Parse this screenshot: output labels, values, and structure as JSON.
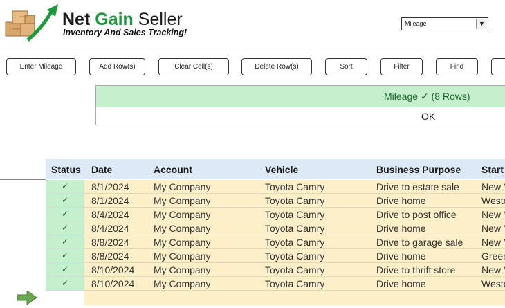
{
  "brand": {
    "title_net": "Net",
    "title_gain": "Gain",
    "title_seller": "Seller",
    "subtitle": "Inventory And Sales Tracking!"
  },
  "sheet_selector": {
    "value": "Mileage"
  },
  "toolbar": {
    "buttons": [
      "Enter Mileage",
      "Add Row(s)",
      "Clear Cell(s)",
      "Delete Row(s)",
      "Sort",
      "Filter",
      "Find",
      ""
    ]
  },
  "banner": {
    "text": "Mileage ✓ (8 Rows)",
    "ok": "OK"
  },
  "table": {
    "headers": [
      "Status",
      "Date",
      "Account",
      "Vehicle",
      "Business Purpose",
      "Start"
    ],
    "rows": [
      {
        "status": "✓",
        "date": "8/1/2024",
        "account": "My Company",
        "vehicle": "Toyota Camry",
        "purpose": "Drive to estate sale",
        "start": "New Y"
      },
      {
        "status": "✓",
        "date": "8/1/2024",
        "account": "My Company",
        "vehicle": "Toyota Camry",
        "purpose": "Drive home",
        "start": "Westc"
      },
      {
        "status": "✓",
        "date": "8/4/2024",
        "account": "My Company",
        "vehicle": "Toyota Camry",
        "purpose": "Drive to post office",
        "start": "New Y"
      },
      {
        "status": "✓",
        "date": "8/4/2024",
        "account": "My Company",
        "vehicle": "Toyota Camry",
        "purpose": "Drive home",
        "start": "New Y"
      },
      {
        "status": "✓",
        "date": "8/8/2024",
        "account": "My Company",
        "vehicle": "Toyota Camry",
        "purpose": "Drive to garage sale",
        "start": "New Y"
      },
      {
        "status": "✓",
        "date": "8/8/2024",
        "account": "My Company",
        "vehicle": "Toyota Camry",
        "purpose": "Drive home",
        "start": "Green"
      },
      {
        "status": "✓",
        "date": "8/10/2024",
        "account": "My Company",
        "vehicle": "Toyota Camry",
        "purpose": "Drive to thrift store",
        "start": "New Y"
      },
      {
        "status": "✓",
        "date": "8/10/2024",
        "account": "My Company",
        "vehicle": "Toyota Camry",
        "purpose": "Drive home",
        "start": "Westc"
      }
    ]
  },
  "colors": {
    "accent_green": "#1a9a3a",
    "status_fill": "#c6efce",
    "row_fill": "#fdf0c8",
    "header_fill": "#dde9f6"
  },
  "icons": {
    "logo": "boxes-with-growth-arrow-icon",
    "new_row": "right-arrow-icon",
    "dropdown": "triangle-down-icon"
  }
}
